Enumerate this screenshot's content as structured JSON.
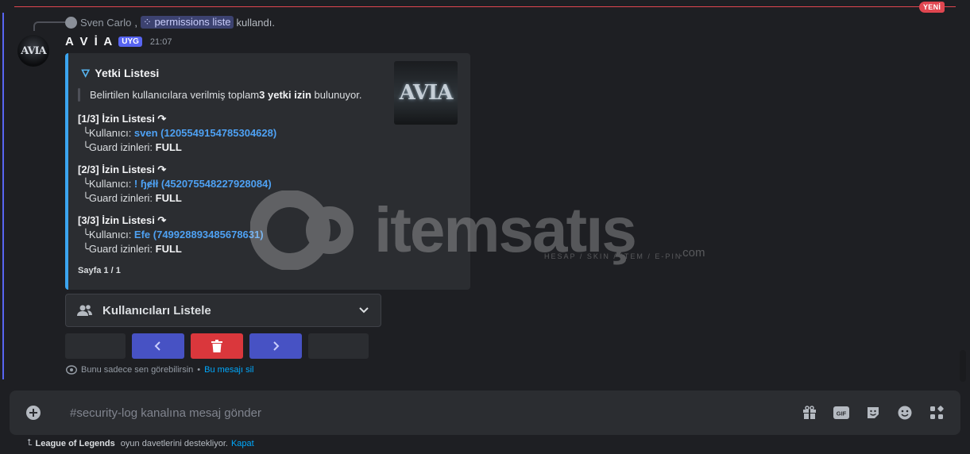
{
  "new_marker": "YENİ",
  "reply": {
    "user": "Sven Carlo",
    "command": "permissions liste",
    "suffix": "kullandı."
  },
  "message": {
    "author": "A V İ A",
    "tag": "UYG",
    "time": "21:07",
    "avatar_text": "AVIA"
  },
  "embed": {
    "title": "Yetki Listesi",
    "thumbnail_text": "AVIA",
    "quote_pre": "Belirtilen kullanıcılara verilmiş toplam ",
    "quote_bold": "3 yetki izin",
    "quote_post": " bulunuyor.",
    "entries": [
      {
        "head": "[1/3] İzin Listesi ↷",
        "user_label": "Kullanıcı: ",
        "user": "sven (1205549154785304628)",
        "guard_label": "Guard izinleri: ",
        "guard": "FULL"
      },
      {
        "head": "[2/3] İzin Listesi ↷",
        "user_label": "Kullanıcı: ",
        "user": "! ɧɇłł (452075548227928084)",
        "guard_label": "Guard izinleri: ",
        "guard": "FULL"
      },
      {
        "head": "[3/3] İzin Listesi ↷",
        "user_label": "Kullanıcı: ",
        "user": "Efe (749928893485678631)",
        "guard_label": "Guard izinleri: ",
        "guard": "FULL"
      }
    ],
    "footer": "Sayfa 1 / 1"
  },
  "select_menu": {
    "label": "Kullanıcıları Listele"
  },
  "ephemeral": {
    "text": "Bunu sadece sen görebilirsin",
    "separator": "•",
    "link": "Bu mesajı sil"
  },
  "composer": {
    "placeholder": "#security-log kanalına mesaj gönder"
  },
  "activity": {
    "game": "League of Legends",
    "text": " oyun davetlerini destekliyor.",
    "link": "Kapat"
  },
  "watermark": {
    "text": "itemsatış",
    "sub": "HESAP / SKIN / ITEM / E-PIN",
    "com": ".com"
  },
  "colors": {
    "accent": "#5865f2",
    "embed_border": "#3ba5f0",
    "danger": "#da373c",
    "link": "#4ea1f3"
  }
}
